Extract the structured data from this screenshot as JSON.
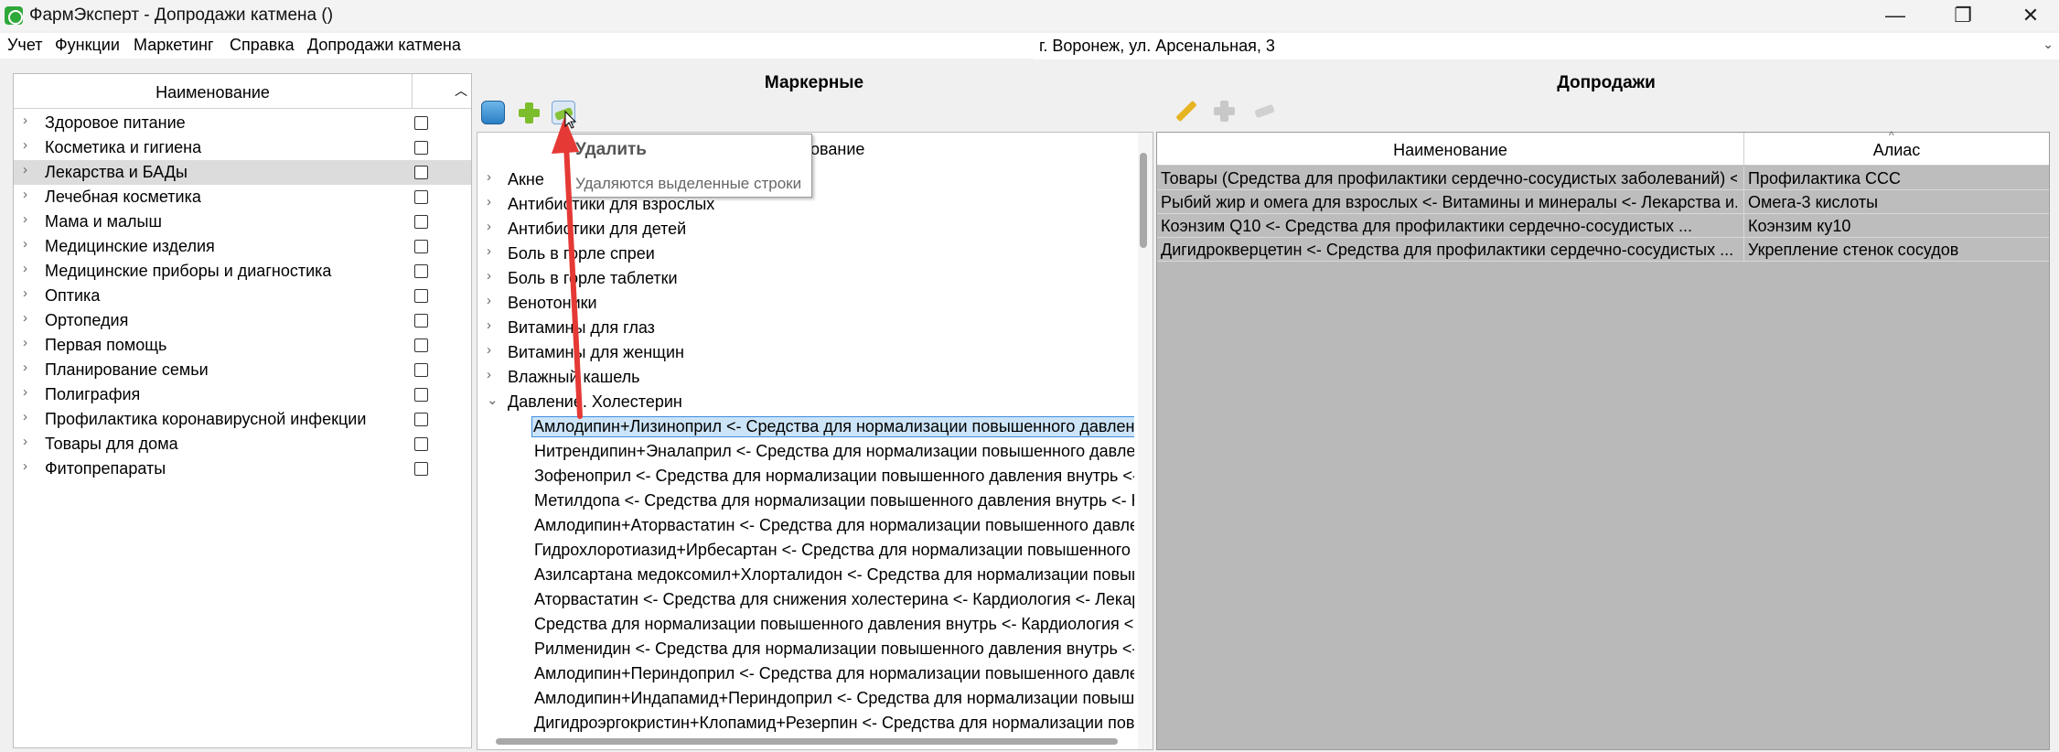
{
  "window": {
    "title": "ФармЭксперт - Допродажи катмена ()",
    "min_glyph": "—",
    "max_glyph": "❐",
    "close_glyph": "✕"
  },
  "menu": {
    "items": [
      "Учет",
      "Функции",
      "Маркетинг",
      "Справка",
      "Допродажи катмена"
    ],
    "location": "г. Воронеж, ул. Арсенальная, 3"
  },
  "left": {
    "header": "Наименование",
    "categories": [
      "Здоровое питание",
      "Косметика и гигиена",
      "Лекарства и БАДы",
      "Лечебная косметика",
      "Мама и малыш",
      "Медицинские изделия",
      "Медицинские приборы и диагностика",
      "Оптика",
      "Ортопедия",
      "Первая помощь",
      "Планирование семьи",
      "Полиграфия",
      "Профилактика коронавирусной инфекции",
      "Товары для дома",
      "Фитопрепараты"
    ],
    "selected_index": 2
  },
  "middle": {
    "title": "Маркерные",
    "header": "ование",
    "groups": [
      "Акне",
      "Антибиотики для взрослых",
      "Антибиотики для детей",
      "Боль в горле спреи",
      "Боль в горле таблетки",
      "Венотоники",
      "Витамины для глаз",
      "Витамины для женщин",
      "Влажный кашель",
      "Давление. Холестерин"
    ],
    "children": [
      "Амлодипин+Лизиноприл <- Средства для нормализации повышенного давления",
      "Нитрендипин+Эналаприл  <- Средства для нормализации повышенного давле...",
      "Зофеноприл <- Средства для нормализации повышенного давления внутрь <- ...",
      "Метилдопа <- Средства для нормализации повышенного давления внутрь <- К...",
      "Амлодипин+Аторвастатин <- Средства для нормализации повышенного давле...",
      "Гидрохлоротиазид+Ирбесартан <- Средства для нормализации повышенного ...",
      "Азилсартана медоксомил+Хлорталидон <- Средства для нормализации повыш...",
      "Аторвастатин <- Средства для снижения холестерина <- Кардиология <- Лекар...",
      "Средства для нормализации повышенного давления внутрь <- Кардиология <- ...",
      "Рилменидин <- Средства для нормализации повышенного давления внутрь <- ...",
      "Амлодипин+Периндоприл  <- Средства для нормализации повышенного давле...",
      "Амлодипин+Индапамид+Периндоприл <- Средства для нормализации повыш...",
      "Дигидроэргокристин+Клопамид+Резерпин <- Средства для нормализации пов..."
    ],
    "selected_child": 0
  },
  "tooltip": {
    "title": "Удалить",
    "description": "Удаляются выделенные строки"
  },
  "right": {
    "title": "Допродажи",
    "columns": [
      "Наименование",
      "Алиас"
    ],
    "rows": [
      {
        "name": "Товары (Средства для профилактики сердечно-сосудистых заболеваний) <...",
        "alias": "Профилактика ССС"
      },
      {
        "name": "Рыбий жир и омега для взрослых <- Витамины и минералы <- Лекарства и...",
        "alias": "Омега-3 кислоты"
      },
      {
        "name": "Коэнзим Q10 <- Средства для профилактики сердечно-сосудистых ...",
        "alias": "Коэнзим ку10"
      },
      {
        "name": "Дигидрокверцетин <- Средства для профилактики сердечно-сосудистых ...",
        "alias": "Укрепление стенок сосудов"
      }
    ]
  },
  "icons": [
    "app-icon",
    "database-icon",
    "add-icon",
    "delete-icon",
    "edit-icon",
    "add-disabled-icon",
    "delete-disabled-icon",
    "chevron-right-icon",
    "chevron-down-icon",
    "sort-up-icon"
  ],
  "colors": {
    "accent_selection": "#cce4f7",
    "arrow": "#e53935",
    "right_panel_bg": "#b9b9b9"
  }
}
